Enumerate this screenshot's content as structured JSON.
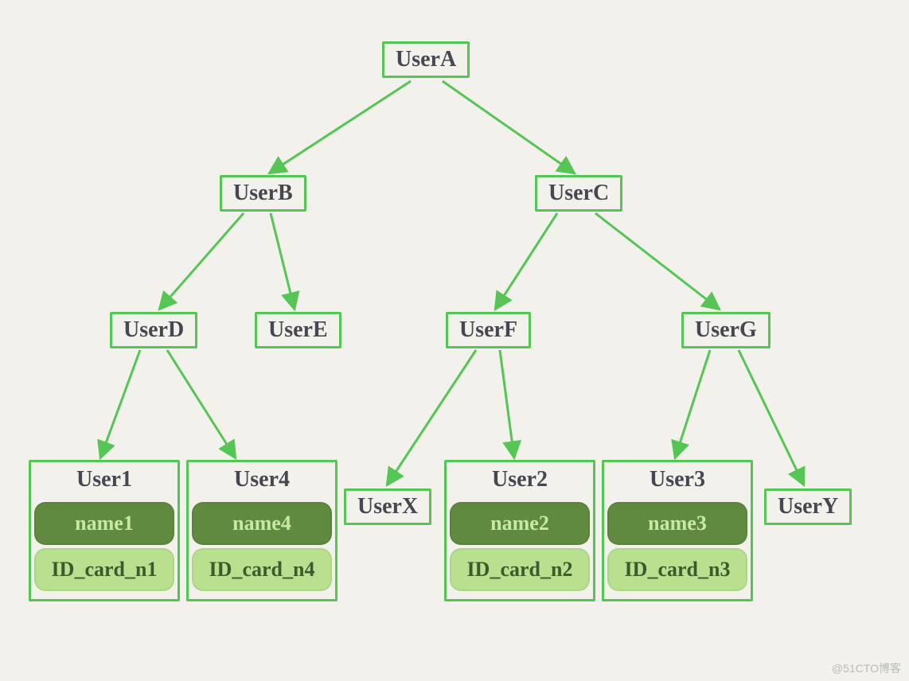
{
  "nodes": {
    "userA": "UserA",
    "userB": "UserB",
    "userC": "UserC",
    "userD": "UserD",
    "userE": "UserE",
    "userF": "UserF",
    "userG": "UserG",
    "userX": "UserX",
    "userY": "UserY",
    "user1": {
      "title": "User1",
      "name": "name1",
      "id": "ID_card_n1"
    },
    "user4": {
      "title": "User4",
      "name": "name4",
      "id": "ID_card_n4"
    },
    "user2": {
      "title": "User2",
      "name": "name2",
      "id": "ID_card_n2"
    },
    "user3": {
      "title": "User3",
      "name": "name3",
      "id": "ID_card_n3"
    }
  },
  "watermark": "@51CTO博客"
}
